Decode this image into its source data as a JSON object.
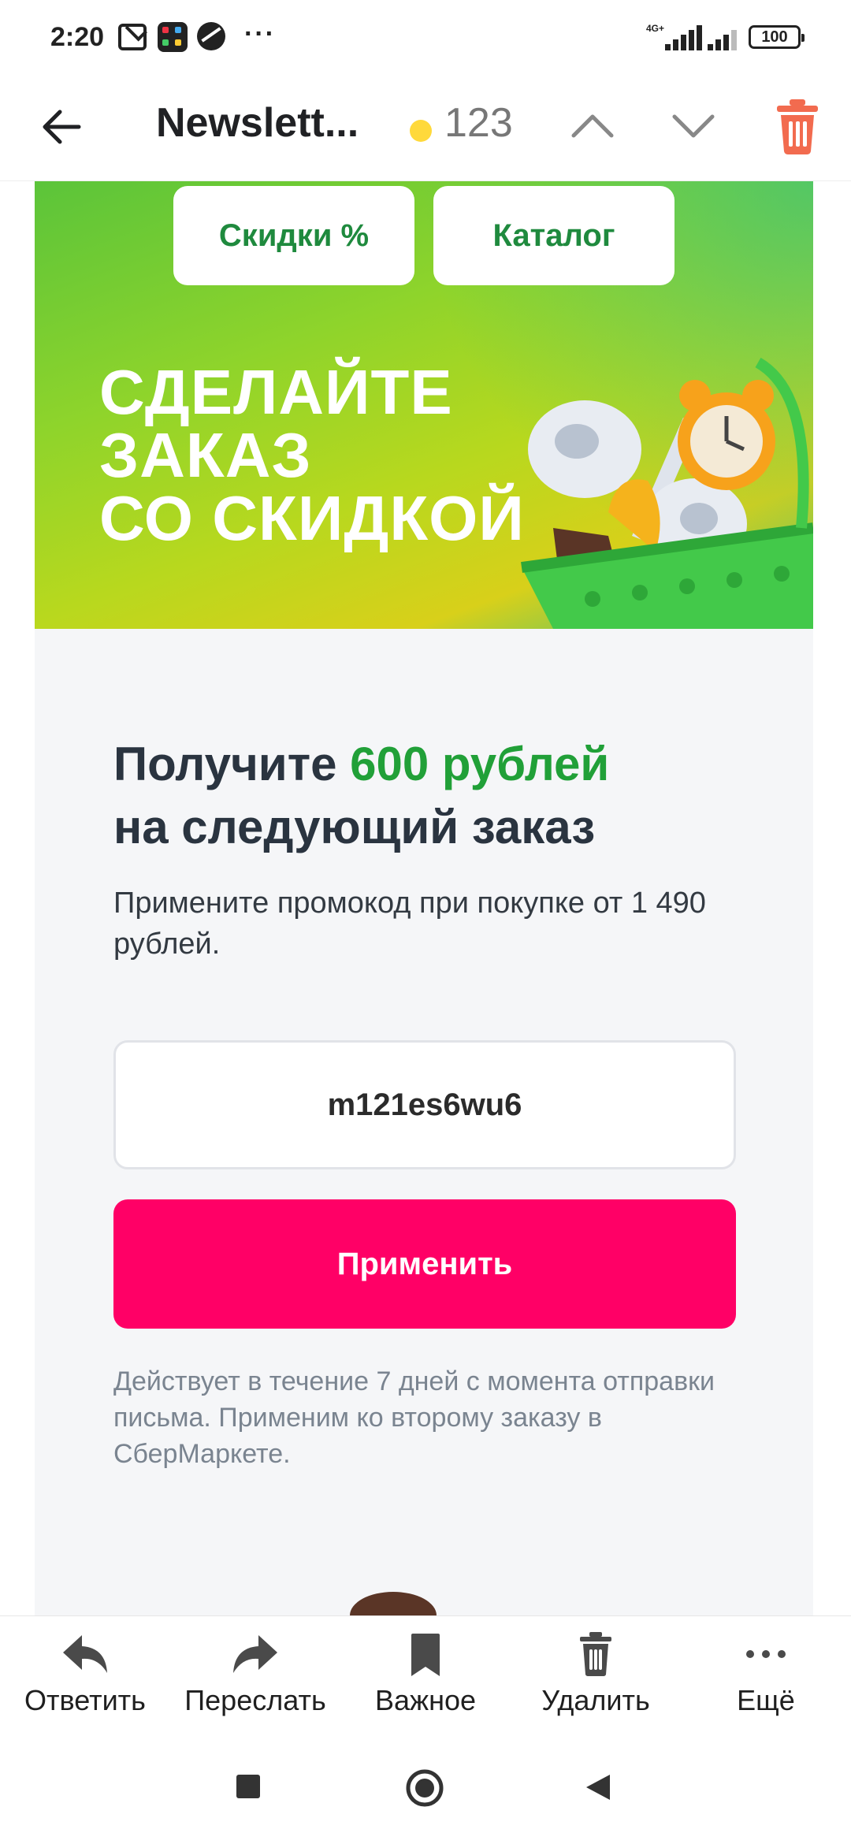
{
  "status_bar": {
    "time": "2:20",
    "more": "···",
    "network": "4G+",
    "battery": "100"
  },
  "header": {
    "title": "Newslett...",
    "coin_count": "123"
  },
  "email": {
    "banner": {
      "pill_discounts": "Скидки %",
      "pill_catalog": "Каталог",
      "headline_1": "СДЕЛАЙТЕ",
      "headline_2": "ЗАКАЗ",
      "headline_3": "СО СКИДКОЙ"
    },
    "promo": {
      "title_prefix": "Получите ",
      "title_accent": "600 рублей",
      "title_line2": "на следующий заказ",
      "subtitle": "Примените промокод при покупке от 1 490 рублей.",
      "code": "m121es6wu6",
      "apply_label": "Применить",
      "note": "Действует в течение 7 дней с момента отправки письма. Применим ко второму заказу в СберМаркете."
    }
  },
  "actions": [
    {
      "label": "Ответить",
      "icon": "reply-icon"
    },
    {
      "label": "Переслать",
      "icon": "forward-icon"
    },
    {
      "label": "Важное",
      "icon": "bookmark-icon"
    },
    {
      "label": "Удалить",
      "icon": "trash-icon"
    },
    {
      "label": "Ещё",
      "icon": "more-icon"
    }
  ],
  "colors": {
    "accent_green": "#21a038",
    "apply_button": "#ff0066",
    "trash_orange": "#f26b4f",
    "coin_yellow": "#ffd93b"
  }
}
